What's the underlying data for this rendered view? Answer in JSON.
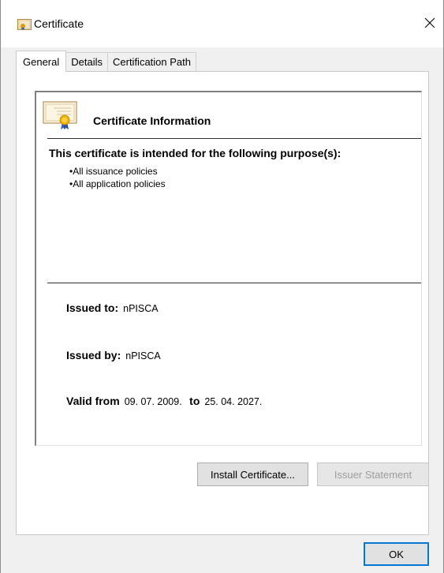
{
  "window": {
    "title": "Certificate",
    "close_glyph": "✕",
    "icon": "certificate-icon"
  },
  "tabs": [
    {
      "label": "General",
      "active": true
    },
    {
      "label": "Details",
      "active": false
    },
    {
      "label": "Certification Path",
      "active": false
    }
  ],
  "info": {
    "heading": "Certificate Information",
    "purpose_heading": "This certificate is intended for the following purpose(s):",
    "purposes": [
      "All issuance policies",
      "All application policies"
    ],
    "issued_to_label": "Issued to:",
    "issued_to_value": "nPISCA",
    "issued_by_label": "Issued by:",
    "issued_by_value": "nPISCA",
    "valid_from_label": "Valid from",
    "valid_from_value": "09. 07. 2009.",
    "valid_to_label": "to",
    "valid_to_value": "25. 04. 2027."
  },
  "buttons": {
    "install": "Install Certificate...",
    "issuer_statement": "Issuer Statement",
    "ok": "OK"
  },
  "colors": {
    "accent": "#0078d7",
    "disabled_text": "#9d9d9d"
  }
}
